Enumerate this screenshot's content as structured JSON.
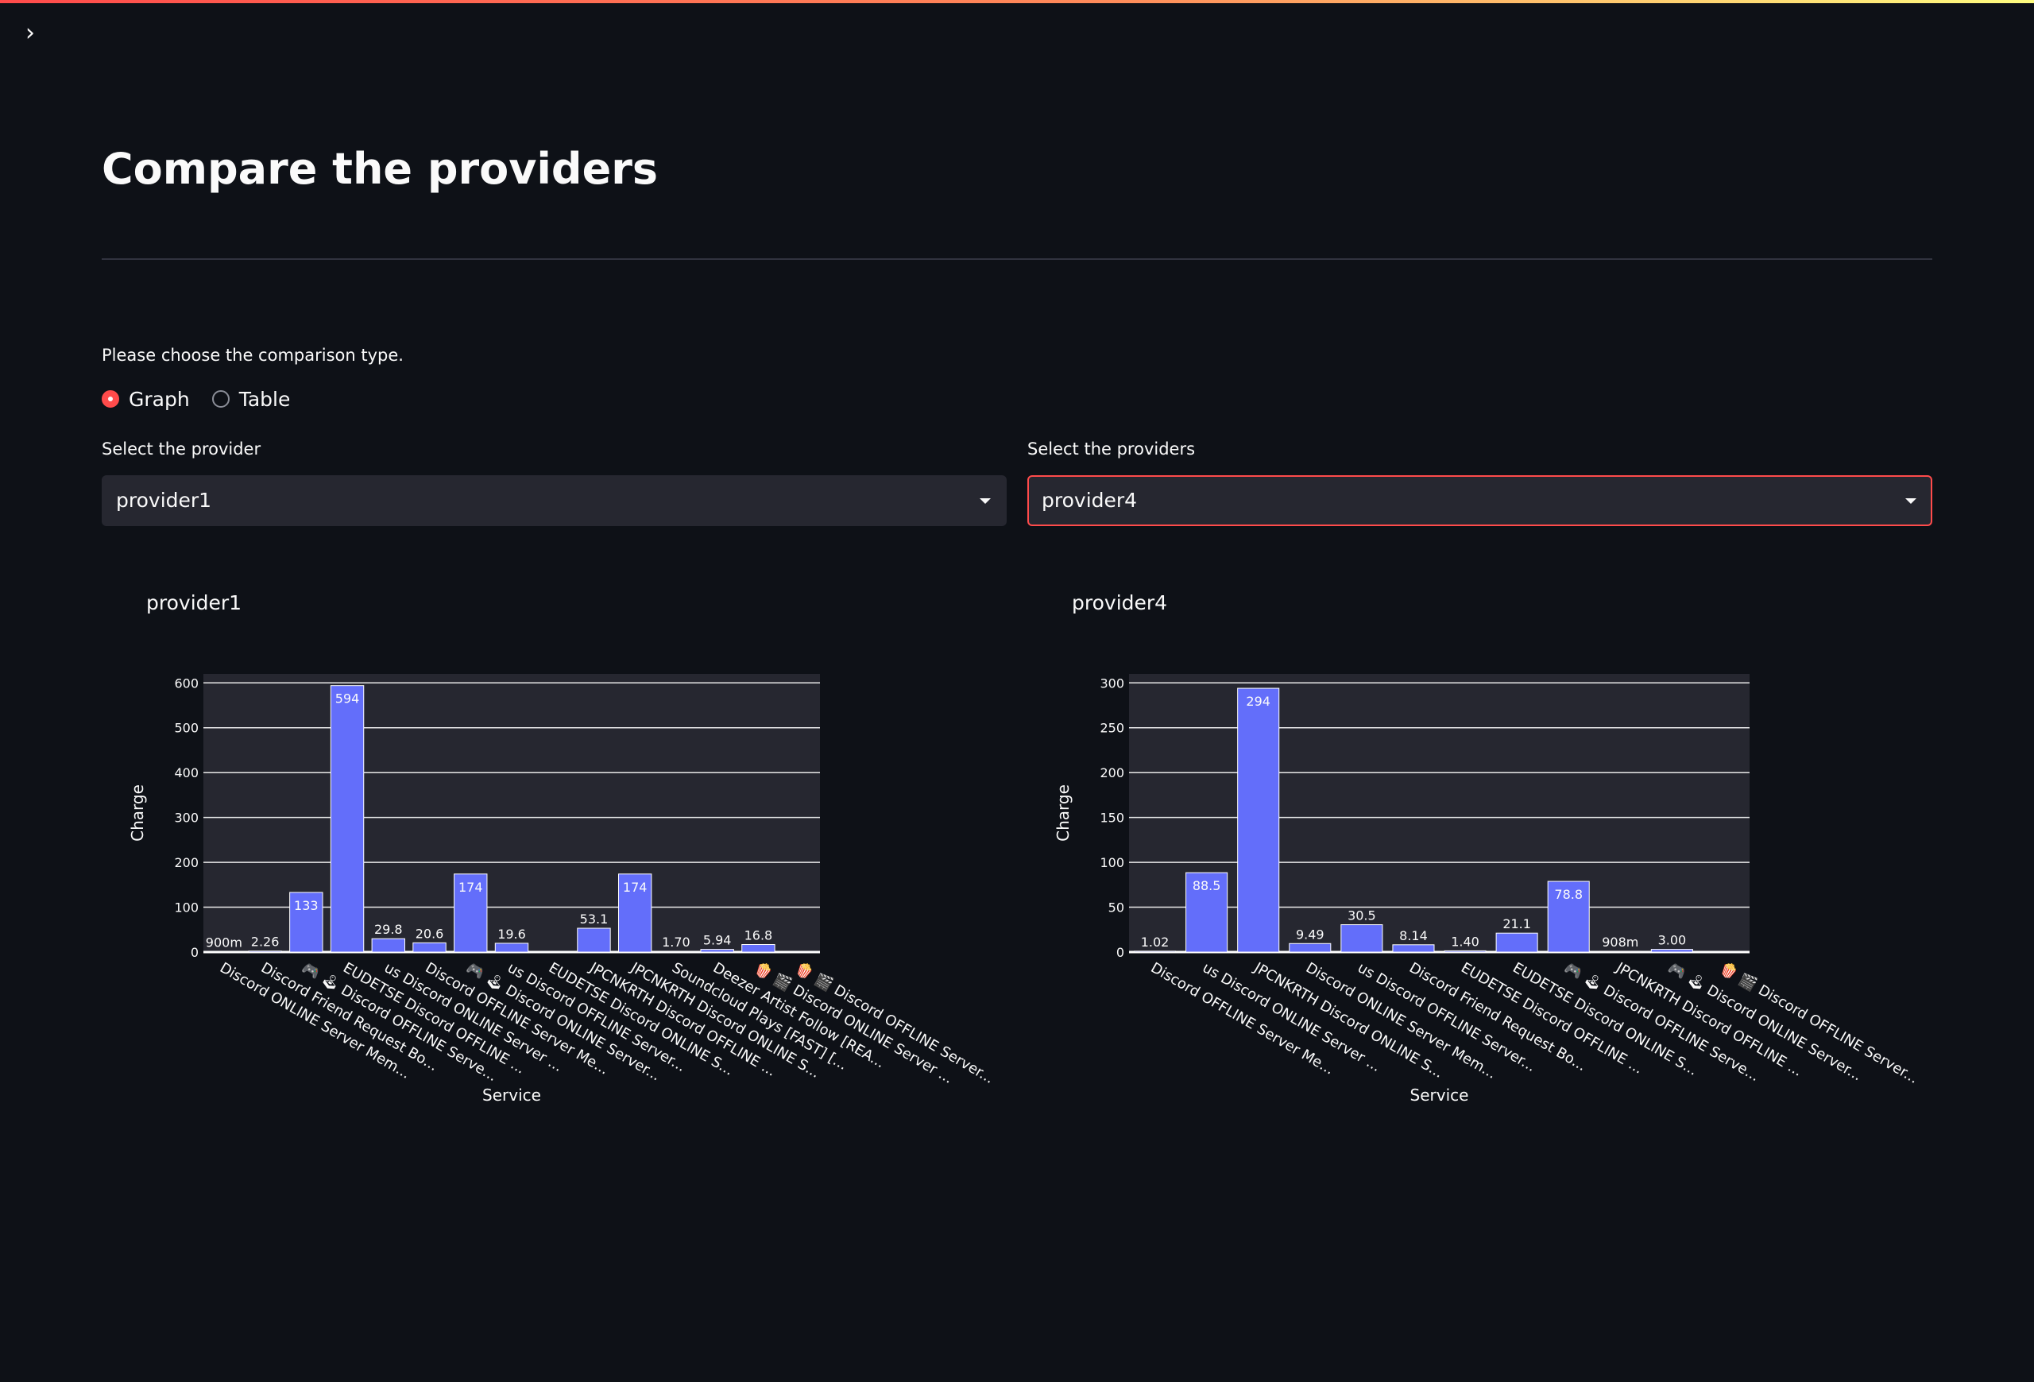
{
  "page": {
    "title": "Compare the providers",
    "comparison_prompt": "Please choose the comparison type.",
    "comparison_options": [
      "Graph",
      "Table"
    ],
    "comparison_selected": "Graph",
    "provider_label": "Select the provider",
    "providers_label": "Select the providers",
    "provider_value": "provider1",
    "providers_value": "provider4",
    "left_chart_title": "provider1",
    "right_chart_title": "provider4"
  },
  "colors": {
    "background": "#0e1117",
    "plot_background": "#262730",
    "bar": "#636efa",
    "accent": "#ff4b4b"
  },
  "chart_data": [
    {
      "type": "bar",
      "title": "provider1",
      "xlabel": "Service",
      "ylabel": "Charge",
      "ylim": [
        0,
        620
      ],
      "yticks": [
        0,
        100,
        200,
        300,
        400,
        500,
        600
      ],
      "categories": [
        "Discord ONLINE Server Mem...",
        "Discord Friend Request Bo...",
        "🎮 🕹 Discord OFFLINE Serve...",
        "EUDETSE Discord OFFLINE ...",
        "us Discord ONLINE Server ...",
        "Discord OFFLINE Server Me...",
        "🎮 🕹 Discord ONLINE Server...",
        "us Discord OFFLINE Server...",
        "EUDETSE Discord ONLINE S...",
        "JPCNKRTH Discord OFFLINE ...",
        "JPCNKRTH Discord ONLINE S...",
        "Soundcloud Plays [FAST] [...",
        "Deezer Artist Follow [REA...",
        "🍿 🎬 Discord ONLINE Server ...",
        "🍿 🎬 Discord OFFLINE Server..."
      ],
      "values": [
        0.9,
        2.26,
        133,
        594,
        29.8,
        20.6,
        174,
        19.6,
        0,
        53.1,
        174,
        1.7,
        5.94,
        16.8,
        0
      ],
      "value_labels": [
        "900m",
        "2.26",
        "133",
        "594",
        "29.8",
        "20.6",
        "174",
        "19.6",
        "",
        "53.1",
        "174",
        "1.70",
        "5.94",
        "16.8",
        ""
      ]
    },
    {
      "type": "bar",
      "title": "provider4",
      "xlabel": "Service",
      "ylabel": "Charge",
      "ylim": [
        0,
        310
      ],
      "yticks": [
        0,
        50,
        100,
        150,
        200,
        250,
        300
      ],
      "categories": [
        "Discord OFFLINE Server Me...",
        "us Discord ONLINE Server ...",
        "JPCNKRTH Discord ONLINE S...",
        "Discord ONLINE Server Mem...",
        "us Discord OFFLINE Server...",
        "Discord Friend Request Bo...",
        "EUDETSE Discord OFFLINE ...",
        "EUDETSE Discord ONLINE S...",
        "🎮 🕹 Discord OFFLINE Serve...",
        "JPCNKRTH Discord OFFLINE ...",
        "🎮 🕹 Discord ONLINE Server...",
        "🍿 🎬 Discord OFFLINE Server..."
      ],
      "values": [
        1.02,
        88.5,
        294,
        9.49,
        30.5,
        8.14,
        1.4,
        21.1,
        78.8,
        0.908,
        3.0,
        0
      ],
      "value_labels": [
        "1.02",
        "88.5",
        "294",
        "9.49",
        "30.5",
        "8.14",
        "1.40",
        "21.1",
        "78.8",
        "908m",
        "3.00",
        ""
      ]
    }
  ]
}
